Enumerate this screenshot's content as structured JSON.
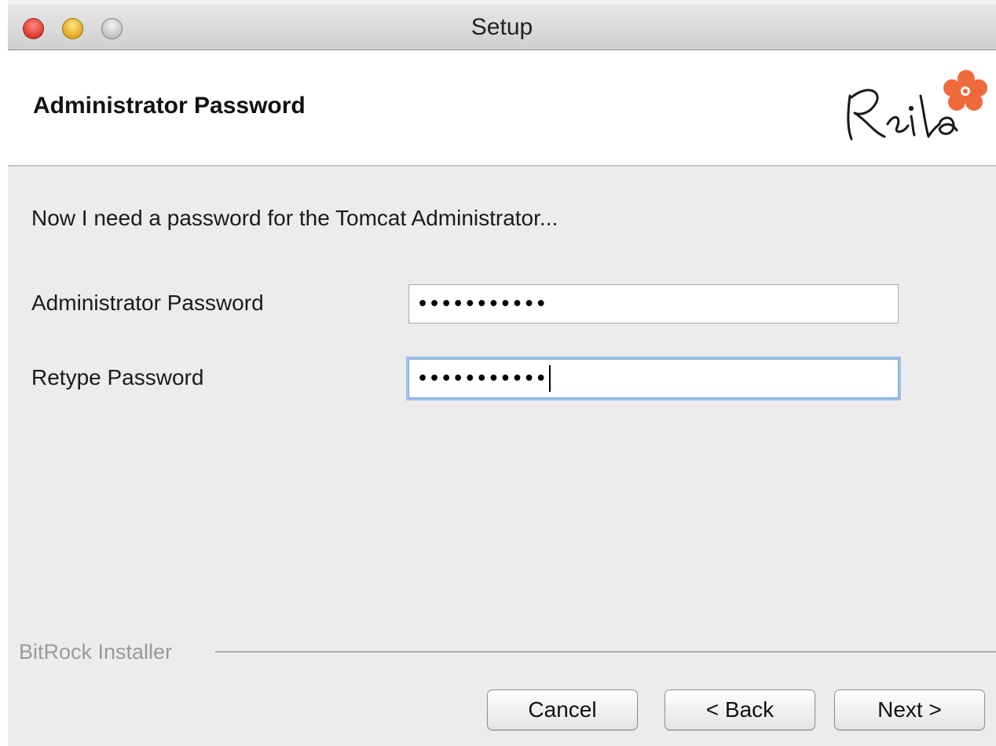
{
  "window": {
    "title": "Setup"
  },
  "header": {
    "title": "Administrator Password",
    "logo_name": "railo-logo"
  },
  "main": {
    "intro": "Now I need a password for the Tomcat Administrator...",
    "fields": [
      {
        "label": "Administrator Password",
        "value": "•••••••••••",
        "focused": false
      },
      {
        "label": "Retype Password",
        "value": "•••••••••••",
        "focused": true
      }
    ]
  },
  "footer": {
    "installer_label": "BitRock Installer",
    "buttons": {
      "cancel": "Cancel",
      "back": "< Back",
      "next": "Next >"
    }
  },
  "colors": {
    "close": "#d9362b",
    "minimize": "#e0a81a",
    "logo_accent": "#ef6a3a",
    "focus_ring": "#9cc1ea"
  }
}
